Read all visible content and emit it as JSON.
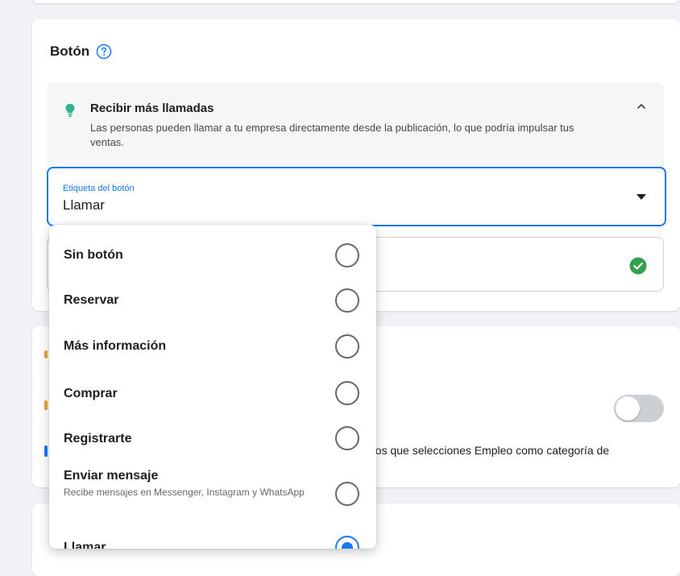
{
  "boton_section": {
    "title": "Botón",
    "tip": {
      "title": "Recibir más llamadas",
      "description": "Las personas pueden llamar a tu empresa directamente desde la publicación, lo que podría impulsar tus ventas."
    },
    "button_label_field": {
      "label": "Etiqueta del botón",
      "value": "Llamar"
    }
  },
  "mid_section": {
    "text": "nos que selecciones Empleo como categoría de",
    "toggle_on": false
  },
  "dropdown": {
    "options": [
      {
        "label": "Sin botón",
        "selected": false
      },
      {
        "label": "Reservar",
        "selected": false
      },
      {
        "label": "Más información",
        "selected": false
      },
      {
        "label": "Comprar",
        "selected": false
      },
      {
        "label": "Registrarte",
        "selected": false
      },
      {
        "label": "Enviar mensaje",
        "description": "Recibe mensajes en Messenger, Instagram y WhatsApp",
        "selected": false
      },
      {
        "label": "Llamar",
        "selected": true
      }
    ]
  },
  "colors": {
    "accent": "#1877f2",
    "success": "#31a24c",
    "background": "#f0f2f5"
  },
  "icons": {
    "help": "question-circle-icon",
    "bulb": "lightbulb-icon",
    "collapse": "chevron-up-icon",
    "caret": "caret-down-icon",
    "check": "check-circle-icon"
  }
}
